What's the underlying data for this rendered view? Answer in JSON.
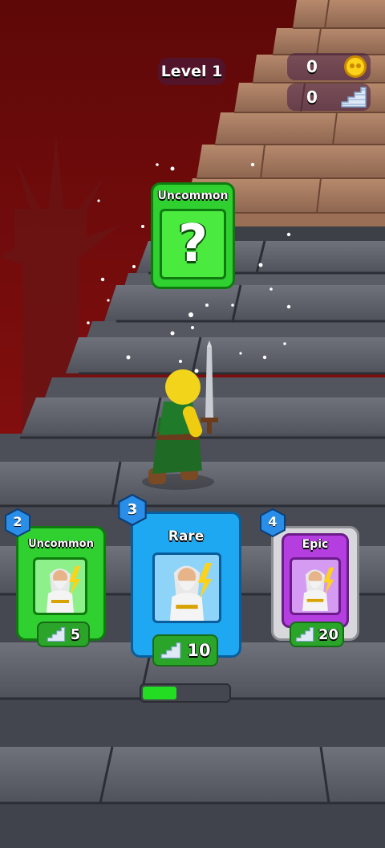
{
  "hud": {
    "level_label": "Level 1",
    "coins": "0",
    "steps": "0",
    "coin_icon": "coin-icon",
    "steps_icon": "stairs-icon"
  },
  "mystery_card": {
    "rarity": "Uncommon",
    "symbol": "?"
  },
  "upgrade_cards": [
    {
      "level": "2",
      "rarity": "Uncommon",
      "cost": "5",
      "color": "#2fd02f"
    },
    {
      "level": "3",
      "rarity": "Rare",
      "cost": "10",
      "color": "#1ea8f2"
    },
    {
      "level": "4",
      "rarity": "Epic",
      "cost": "20",
      "color": "#b43ee0"
    }
  ],
  "progress": {
    "fraction": 0.4,
    "color": "#22dd22"
  }
}
